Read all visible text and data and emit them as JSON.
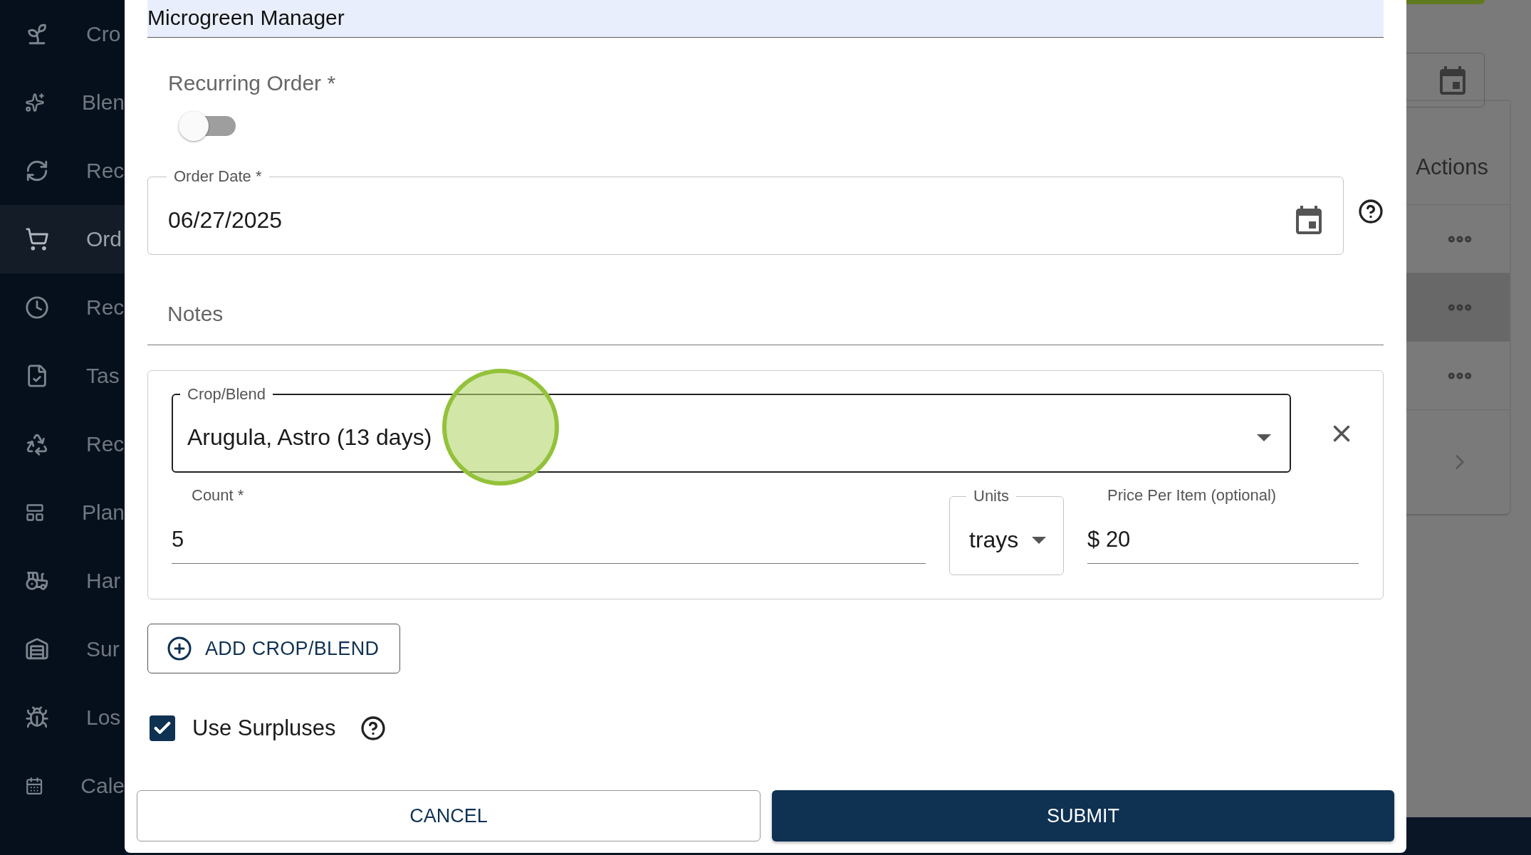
{
  "sidebar": {
    "items": [
      {
        "label": "Cro",
        "selected": false
      },
      {
        "label": "Blen",
        "selected": false
      },
      {
        "label": "Rec",
        "selected": false
      },
      {
        "label": "Ord",
        "selected": true
      },
      {
        "label": "Rec",
        "selected": false
      },
      {
        "label": "Tas",
        "selected": false
      },
      {
        "label": "Rec",
        "selected": false
      },
      {
        "label": "Plan",
        "selected": false
      },
      {
        "label": "Har",
        "selected": false
      },
      {
        "label": "Sur",
        "selected": false
      },
      {
        "label": "Los",
        "selected": false
      },
      {
        "label": "Cale",
        "selected": false
      }
    ]
  },
  "background_table": {
    "header": "Actions",
    "rows": [
      {
        "highlighted": false
      },
      {
        "highlighted": true
      },
      {
        "highlighted": false
      }
    ]
  },
  "dialog": {
    "farm_field": {
      "value": "Microgreen Manager"
    },
    "recurring": {
      "label": "Recurring Order *",
      "on": false
    },
    "order_date": {
      "label": "Order Date *",
      "value": "06/27/2025"
    },
    "notes": {
      "placeholder": "Notes"
    },
    "items": [
      {
        "crop": {
          "label": "Crop/Blend",
          "value": "Arugula, Astro (13 days)"
        },
        "count": {
          "label": "Count *",
          "value": "5"
        },
        "units": {
          "label": "Units",
          "value": "trays"
        },
        "price": {
          "label": "Price Per Item (optional)",
          "prefix": "$",
          "value": "20"
        }
      }
    ],
    "add_button": "ADD CROP/BLEND",
    "use_surpluses": {
      "label": "Use Surpluses",
      "checked": true
    },
    "cancel": "CANCEL",
    "submit": "SUBMIT"
  }
}
